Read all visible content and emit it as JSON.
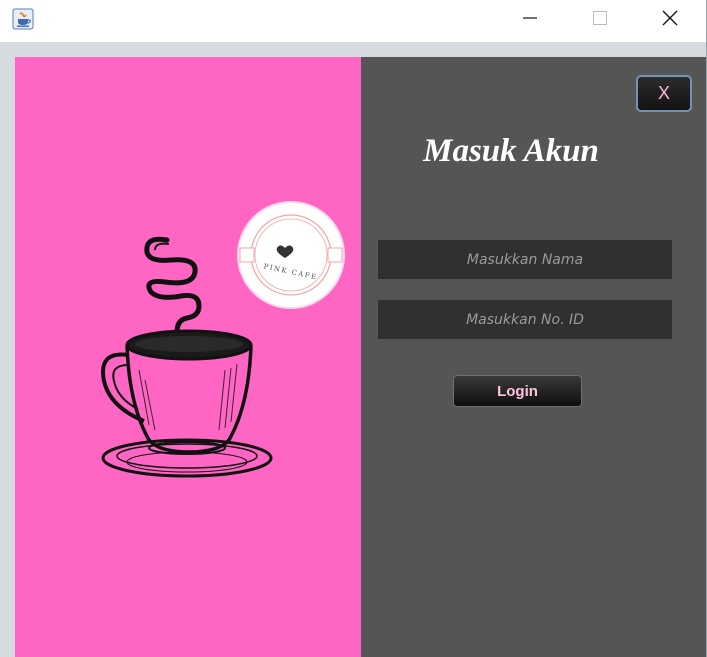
{
  "window": {
    "app_icon": "java-app-icon",
    "controls": {
      "minimize": "minimize-icon",
      "maximize": "maximize-icon",
      "close": "close-icon"
    }
  },
  "login": {
    "close_button_label": "X",
    "heading": "Masuk Akun",
    "name_placeholder": "Masukkan Nama",
    "id_placeholder": "Masukkan No. ID",
    "login_button_label": "Login"
  },
  "brand": {
    "logo_text": "PINK CAFE"
  },
  "colors": {
    "left_panel": "#ff66c4",
    "right_panel": "#555555",
    "field_bg": "#303030",
    "accent_pink": "#ffc2e0"
  }
}
